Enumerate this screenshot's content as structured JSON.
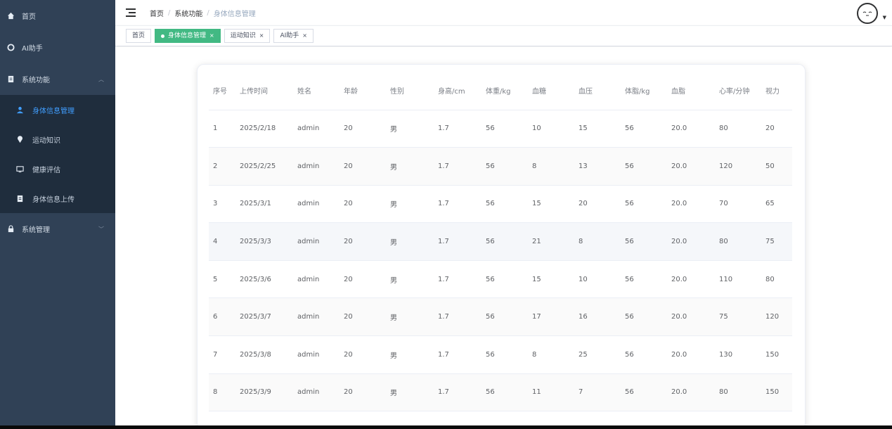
{
  "sidebar": {
    "items": [
      {
        "icon": "home-icon",
        "label": "首页"
      },
      {
        "icon": "ai-icon",
        "label": "AI助手"
      },
      {
        "icon": "document-icon",
        "label": "系统功能"
      },
      {
        "icon": "lock-icon",
        "label": "系统管理"
      }
    ],
    "submenu": [
      {
        "icon": "user-icon",
        "label": "身体信息管理",
        "active": true
      },
      {
        "icon": "location-icon",
        "label": "运动知识"
      },
      {
        "icon": "monitor-icon",
        "label": "健康评估"
      },
      {
        "icon": "document-icon",
        "label": "身体信息上传"
      }
    ]
  },
  "header": {
    "breadcrumb": [
      "首页",
      "系统功能",
      "身体信息管理"
    ]
  },
  "tags": [
    {
      "label": "首页"
    },
    {
      "label": "身体信息管理",
      "active": true
    },
    {
      "label": "运动知识"
    },
    {
      "label": "AI助手"
    }
  ],
  "table": {
    "columns": [
      "序号",
      "上传时间",
      "姓名",
      "年龄",
      "性别",
      "身高/cm",
      "体重/kg",
      "血糖",
      "血压",
      "体脂/kg",
      "血脂",
      "心率/分钟",
      "视力"
    ],
    "rows": [
      [
        "1",
        "2025/2/18",
        "admin",
        "20",
        "男",
        "1.7",
        "56",
        "10",
        "15",
        "56",
        "20.0",
        "80",
        "20"
      ],
      [
        "2",
        "2025/2/25",
        "admin",
        "20",
        "男",
        "1.7",
        "56",
        "8",
        "13",
        "56",
        "20.0",
        "120",
        "50"
      ],
      [
        "3",
        "2025/3/1",
        "admin",
        "20",
        "男",
        "1.7",
        "56",
        "15",
        "20",
        "56",
        "20.0",
        "70",
        "65"
      ],
      [
        "4",
        "2025/3/3",
        "admin",
        "20",
        "男",
        "1.7",
        "56",
        "21",
        "8",
        "56",
        "20.0",
        "80",
        "75"
      ],
      [
        "5",
        "2025/3/6",
        "admin",
        "20",
        "男",
        "1.7",
        "56",
        "15",
        "10",
        "56",
        "20.0",
        "110",
        "80"
      ],
      [
        "6",
        "2025/3/7",
        "admin",
        "20",
        "男",
        "1.7",
        "56",
        "17",
        "16",
        "56",
        "20.0",
        "75",
        "120"
      ],
      [
        "7",
        "2025/3/8",
        "admin",
        "20",
        "男",
        "1.7",
        "56",
        "8",
        "25",
        "56",
        "20.0",
        "130",
        "150"
      ],
      [
        "8",
        "2025/3/9",
        "admin",
        "20",
        "男",
        "1.7",
        "56",
        "11",
        "7",
        "56",
        "20.0",
        "80",
        "150"
      ]
    ]
  },
  "colors": {
    "sidebar_bg": "#304156",
    "submenu_bg": "#1f2d3d",
    "active_tag": "#42b983",
    "active_menu_text": "#409eff"
  }
}
